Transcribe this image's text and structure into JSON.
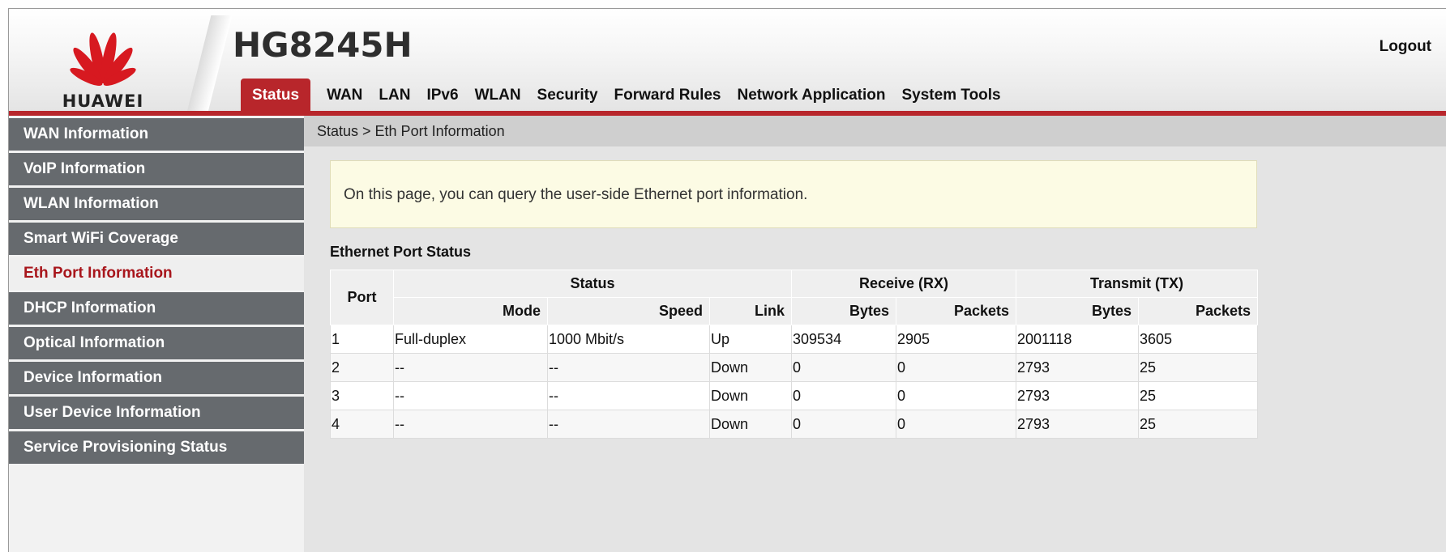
{
  "header": {
    "logo_text": "HUAWEI",
    "product_name": "HG8245H",
    "logout_label": "Logout",
    "brand_color": "#b8262b"
  },
  "nav": {
    "tabs": [
      {
        "label": "Status",
        "active": true
      },
      {
        "label": "WAN"
      },
      {
        "label": "LAN"
      },
      {
        "label": "IPv6"
      },
      {
        "label": "WLAN"
      },
      {
        "label": "Security"
      },
      {
        "label": "Forward Rules"
      },
      {
        "label": "Network Application"
      },
      {
        "label": "System Tools"
      }
    ]
  },
  "sidebar": {
    "items": [
      {
        "label": "WAN Information"
      },
      {
        "label": "VoIP Information"
      },
      {
        "label": "WLAN Information"
      },
      {
        "label": "Smart WiFi Coverage"
      },
      {
        "label": "Eth Port Information",
        "active": true
      },
      {
        "label": "DHCP Information"
      },
      {
        "label": "Optical Information"
      },
      {
        "label": "Device Information"
      },
      {
        "label": "User Device Information"
      },
      {
        "label": "Service Provisioning Status"
      }
    ]
  },
  "main": {
    "breadcrumb": "Status > Eth Port Information",
    "info_text": "On this page, you can query the user-side Ethernet port information.",
    "section_title": "Ethernet Port Status",
    "table": {
      "group_headers": {
        "port": "Port",
        "status": "Status",
        "rx": "Receive (RX)",
        "tx": "Transmit (TX)"
      },
      "columns": [
        "Mode",
        "Speed",
        "Link",
        "Bytes",
        "Packets",
        "Bytes",
        "Packets"
      ],
      "rows": [
        [
          "1",
          "Full-duplex",
          "1000 Mbit/s",
          "Up",
          "309534",
          "2905",
          "2001118",
          "3605"
        ],
        [
          "2",
          "--",
          "--",
          "Down",
          "0",
          "0",
          "2793",
          "25"
        ],
        [
          "3",
          "--",
          "--",
          "Down",
          "0",
          "0",
          "2793",
          "25"
        ],
        [
          "4",
          "--",
          "--",
          "Down",
          "0",
          "0",
          "2793",
          "25"
        ]
      ]
    }
  }
}
